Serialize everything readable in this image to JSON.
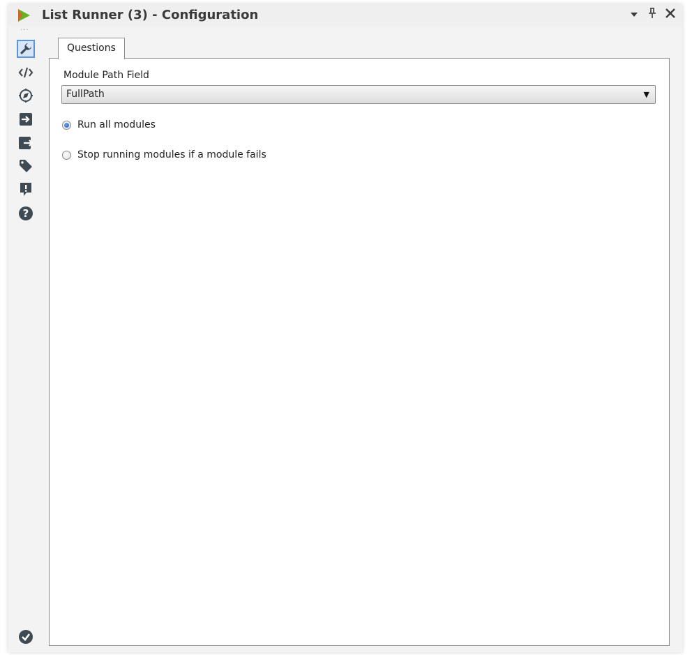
{
  "window": {
    "title": "List Runner (3) - Configuration",
    "controls": {
      "dropdown": "▾",
      "pin": "ᅟ",
      "close": "✕"
    },
    "grip": "···"
  },
  "sidebar": {
    "items": [
      {
        "name": "configuration",
        "icon": "wrench-icon",
        "active": true
      },
      {
        "name": "xml",
        "icon": "code-icon",
        "active": false
      },
      {
        "name": "annotation",
        "icon": "compass-icon",
        "active": false
      },
      {
        "name": "input",
        "icon": "input-arrow-icon",
        "active": false
      },
      {
        "name": "output",
        "icon": "output-arrow-icon",
        "active": false
      },
      {
        "name": "tag",
        "icon": "tag-icon",
        "active": false
      },
      {
        "name": "messages",
        "icon": "alert-icon",
        "active": false
      },
      {
        "name": "help",
        "icon": "help-icon",
        "active": false
      }
    ],
    "bottom": {
      "icon": "check-circle-icon"
    }
  },
  "tabs": [
    {
      "label": "Questions",
      "active": true
    }
  ],
  "form": {
    "module_path_label": "Module Path Field",
    "module_path_value": "FullPath",
    "radios": [
      {
        "label": "Run all modules",
        "checked": true
      },
      {
        "label": "Stop running modules if a module fails",
        "checked": false
      }
    ]
  },
  "colors": {
    "accent": "#5a93d6",
    "icon": "#3f4a52",
    "brand_green": "#6ab023"
  }
}
